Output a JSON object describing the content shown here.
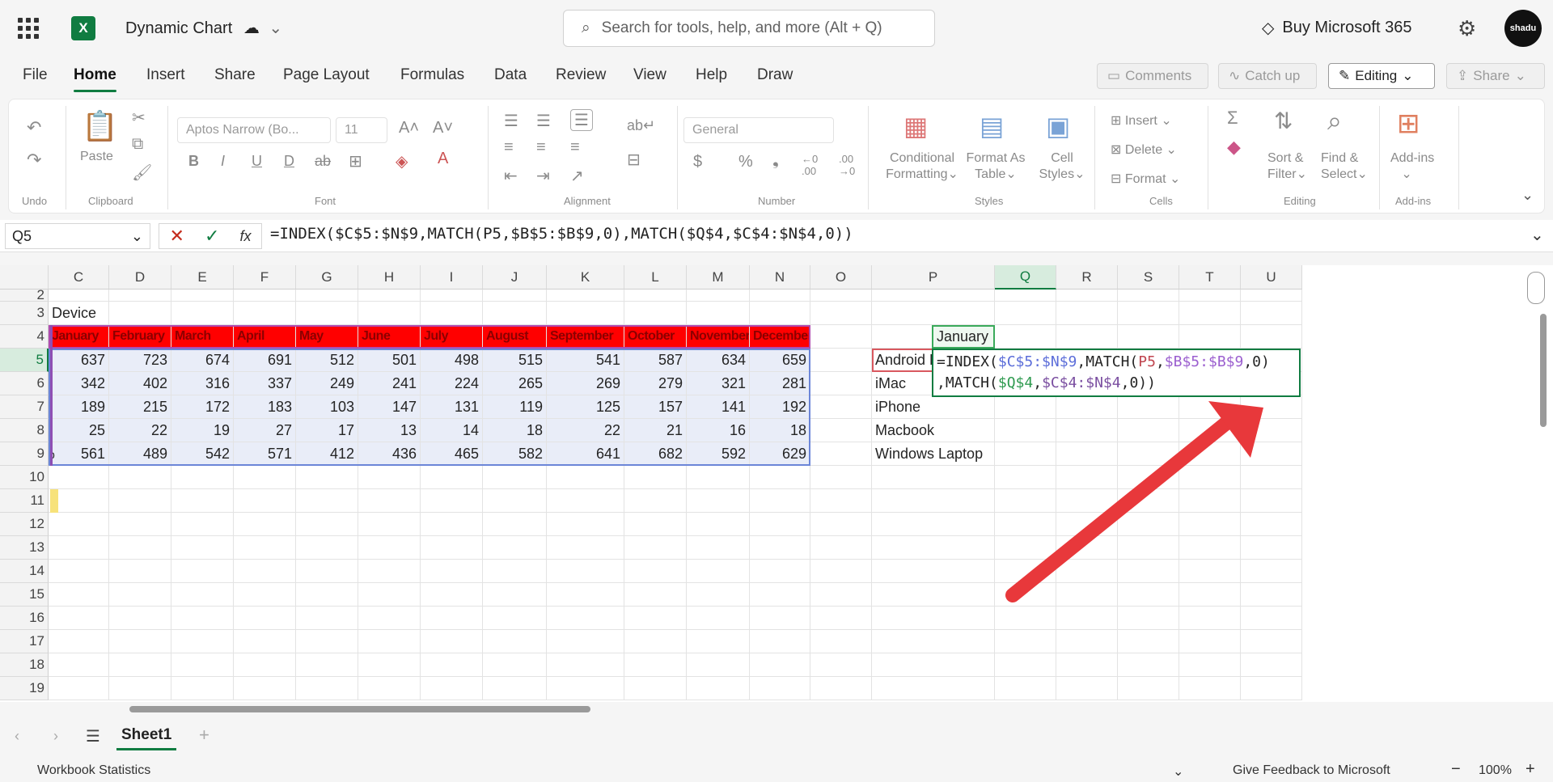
{
  "titlebar": {
    "doc_title": "Dynamic Chart",
    "search_placeholder": "Search for tools, help, and more (Alt + Q)",
    "buy_label": "Buy Microsoft 365",
    "avatar_text": "shadu"
  },
  "menu": {
    "items": [
      "File",
      "Home",
      "Insert",
      "Share",
      "Page Layout",
      "Formulas",
      "Data",
      "Review",
      "View",
      "Help",
      "Draw"
    ],
    "active": "Home",
    "comments": "Comments",
    "catchup": "Catch up",
    "editing": "Editing",
    "share": "Share"
  },
  "ribbon": {
    "undo_label": "Undo",
    "clipboard_label": "Clipboard",
    "paste_label": "Paste",
    "font_name": "Aptos Narrow (Bo...",
    "font_size": "11",
    "font_label": "Font",
    "alignment_label": "Alignment",
    "number_format": "General",
    "number_label": "Number",
    "cond_format_1": "Conditional",
    "cond_format_2": "Formatting",
    "format_table_1": "Format As",
    "format_table_2": "Table",
    "cell_styles_1": "Cell",
    "cell_styles_2": "Styles",
    "styles_label": "Styles",
    "insert": "Insert",
    "delete": "Delete",
    "format": "Format",
    "cells_label": "Cells",
    "sort_1": "Sort &",
    "sort_2": "Filter",
    "find_1": "Find &",
    "find_2": "Select",
    "editing_label": "Editing",
    "addins": "Add-ins",
    "addins_label": "Add-ins"
  },
  "formulabar": {
    "name_box": "Q5",
    "formula": "=INDEX($C$5:$N$9,MATCH(P5,$B$5:$B$9,0),MATCH($Q$4,$C$4:$N$4,0))"
  },
  "grid": {
    "columns": [
      "C",
      "D",
      "E",
      "F",
      "G",
      "H",
      "I",
      "J",
      "K",
      "L",
      "M",
      "N",
      "O",
      "P",
      "Q",
      "R",
      "S",
      "T",
      "U"
    ],
    "rows": [
      "2",
      "3",
      "4",
      "5",
      "6",
      "7",
      "8",
      "9",
      "10",
      "11",
      "12",
      "13",
      "14",
      "15",
      "16",
      "17",
      "18",
      "19"
    ],
    "b3": "Device",
    "months": [
      "January",
      "February",
      "March",
      "April",
      "May",
      "June",
      "July",
      "August",
      "September",
      "October",
      "November",
      "December"
    ],
    "data": [
      [
        637,
        723,
        674,
        691,
        512,
        501,
        498,
        515,
        541,
        587,
        634,
        659
      ],
      [
        342,
        402,
        316,
        337,
        249,
        241,
        224,
        265,
        269,
        279,
        321,
        281
      ],
      [
        189,
        215,
        172,
        183,
        103,
        147,
        131,
        119,
        125,
        157,
        141,
        192
      ],
      [
        25,
        22,
        19,
        27,
        17,
        13,
        14,
        18,
        22,
        21,
        16,
        18
      ],
      [
        561,
        489,
        542,
        571,
        412,
        436,
        465,
        582,
        641,
        682,
        592,
        629
      ]
    ],
    "row9_fragment": "p",
    "devices": [
      "Android Phone",
      "iMac",
      "iPhone",
      "Macbook",
      "Windows Laptop"
    ],
    "q4": "January",
    "edit_line1": [
      "=INDEX(",
      "$C$5:$N$9",
      ",MATCH(",
      "P5",
      ",",
      "$B$5:$B$9",
      ",0)"
    ],
    "edit_line2": [
      ",MATCH(",
      "$Q$4",
      ",",
      "$C$4:$N$4",
      ",0))"
    ]
  },
  "bottom": {
    "sheet": "Sheet1",
    "workbook_stats": "Workbook Statistics",
    "feedback": "Give Feedback to Microsoft",
    "zoom": "100%"
  },
  "colors": {
    "accent": "#107c41",
    "header_fill": "#ff0000",
    "arrow": "#e8383b"
  }
}
